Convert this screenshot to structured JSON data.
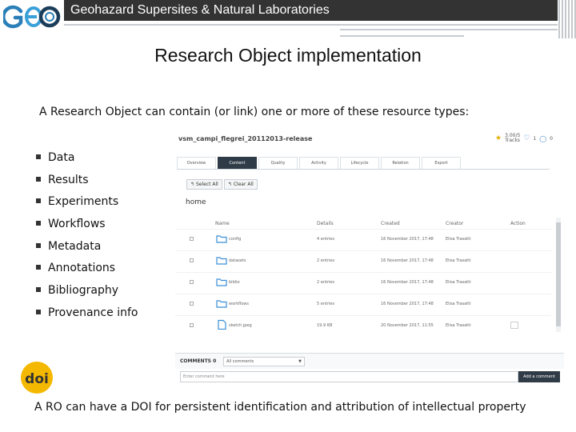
{
  "header": {
    "title": "Geohazard Supersites & Natural Laboratories",
    "logo_text": "GEO"
  },
  "slide": {
    "title": "Research Object implementation",
    "intro": "A Research Object can contain (or link) one or more of these resource types:",
    "bullets": [
      "Data",
      "Results",
      "Experiments",
      "Workflows",
      "Metadata",
      "Annotations",
      "Bibliography",
      "Provenance info"
    ],
    "footer": "A RO can have a DOI for persistent identification and attribution of intellectual property",
    "doi_text": "doi"
  },
  "ro_screen": {
    "title": "vsm_campi_flegrei_20112013-release",
    "score": "3.00/5",
    "score_sub": "Tracks",
    "likes": "1",
    "comments_count": "0",
    "tabs": [
      {
        "label": "Overview",
        "active": false
      },
      {
        "label": "Content",
        "active": true
      },
      {
        "label": "Quality",
        "active": false
      },
      {
        "label": "Activity",
        "active": false
      },
      {
        "label": "Lifecycle",
        "active": false
      },
      {
        "label": "Relation",
        "active": false
      },
      {
        "label": "Export",
        "active": false
      }
    ],
    "buttons": {
      "select_all": "Select All",
      "clear_all": "Clear All"
    },
    "folder": "home",
    "columns": {
      "name": "Name",
      "details": "Details",
      "created": "Created",
      "creator": "Creator",
      "action": "Action"
    },
    "rows": [
      {
        "name": "config",
        "details": "4 entries",
        "created": "16 November 2017, 17:48",
        "creator": "Elisa Trasatti",
        "type": "folder"
      },
      {
        "name": "datasets",
        "details": "2 entries",
        "created": "16 November 2017, 17:48",
        "creator": "Elisa Trasatti",
        "type": "folder"
      },
      {
        "name": "biblio",
        "details": "2 entries",
        "created": "16 November 2017, 17:48",
        "creator": "Elisa Trasatti",
        "type": "folder"
      },
      {
        "name": "workflows",
        "details": "5 entries",
        "created": "16 November 2017, 17:48",
        "creator": "Elisa Trasatti",
        "type": "folder"
      },
      {
        "name": "sketch.jpeg",
        "details": "19.9 KB",
        "created": "20 November 2017, 11:55",
        "creator": "Elisa Trasatti",
        "type": "file"
      }
    ],
    "comments": {
      "label": "COMMENTS",
      "count": "0",
      "filter": "All comments",
      "input_placeholder": "Enter comment here",
      "add_button": "Add a comment"
    }
  },
  "colors": {
    "topbar": "#333333",
    "geo_blue": "#2a7fb8",
    "geo_dark": "#1c3d5a",
    "doi_yellow": "#f5b800",
    "tab_active": "#2f3b47",
    "folder_blue": "#3b8fd6"
  }
}
